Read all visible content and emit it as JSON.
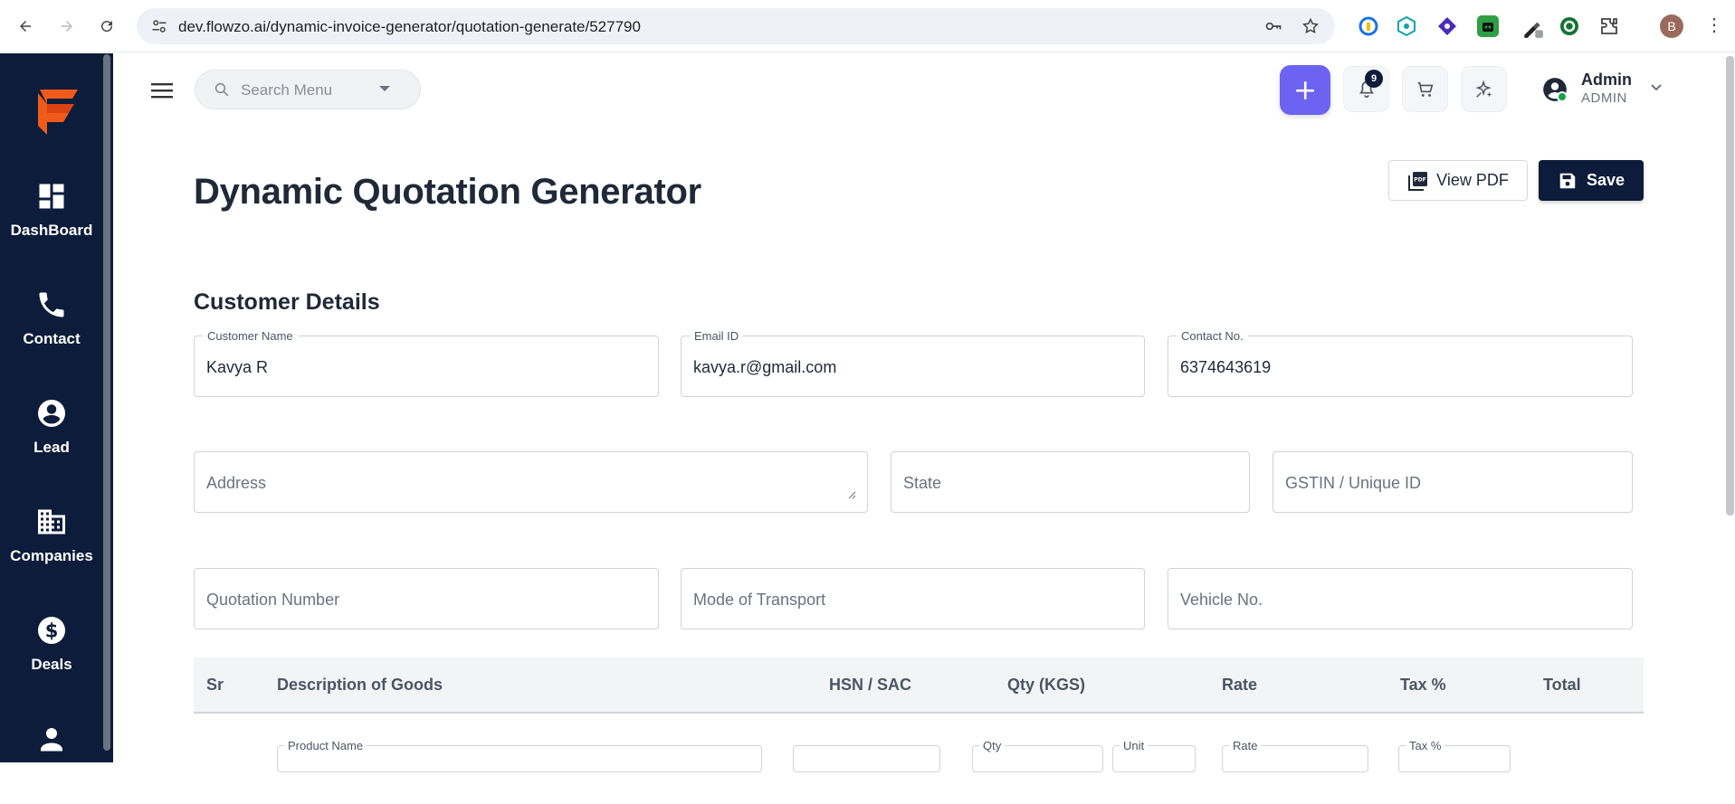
{
  "browser": {
    "url": "dev.flowzo.ai/dynamic-invoice-generator/quotation-generate/527790",
    "profile_initial": "B"
  },
  "sidebar": {
    "items": [
      {
        "label": "DashBoard",
        "icon": "dashboard-icon"
      },
      {
        "label": "Contact",
        "icon": "phone-icon"
      },
      {
        "label": "Lead",
        "icon": "account-circle-icon"
      },
      {
        "label": "Companies",
        "icon": "building-icon"
      },
      {
        "label": "Deals",
        "icon": "dollar-icon"
      },
      {
        "label": "",
        "icon": "person-icon"
      }
    ]
  },
  "topbar": {
    "search_placeholder": "Search Menu",
    "notifications_count": "9",
    "user_name": "Admin",
    "user_role": "ADMIN"
  },
  "page": {
    "title": "Dynamic Quotation Generator",
    "view_pdf_label": "View PDF",
    "save_label": "Save",
    "section_title": "Customer Details"
  },
  "fields": {
    "customer_name": {
      "label": "Customer Name",
      "value": "Kavya R"
    },
    "email": {
      "label": "Email ID",
      "value": "kavya.r@gmail.com"
    },
    "contact": {
      "label": "Contact No.",
      "value": "6374643619"
    },
    "address_placeholder": "Address",
    "state_placeholder": "State",
    "gstin_placeholder": "GSTIN / Unique ID",
    "quotation_number_placeholder": "Quotation Number",
    "mode_of_transport_placeholder": "Mode of Transport",
    "vehicle_no_placeholder": "Vehicle No."
  },
  "table": {
    "headers": [
      "Sr",
      "Description of Goods",
      "HSN / SAC",
      "Qty (KGS)",
      "Rate",
      "Tax %",
      "Total"
    ],
    "row_fields": {
      "product_name": "Product Name",
      "qty": "Qty",
      "unit": "Unit",
      "rate": "Rate",
      "tax": "Tax %"
    }
  },
  "colors": {
    "sidebar_bg": "#0d1c3a",
    "accent": "#6c63f2",
    "logo_orange": "#f05a1a"
  }
}
